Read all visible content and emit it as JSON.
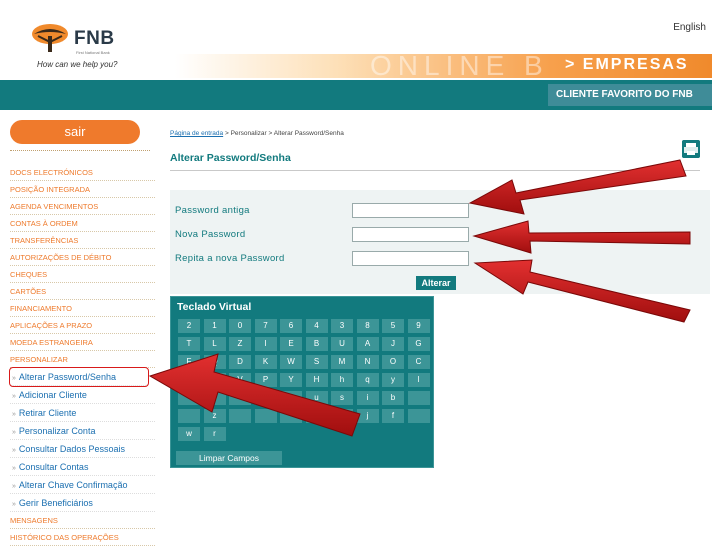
{
  "header": {
    "brand": "FNB",
    "brand_small": "First National Bank",
    "tagline": "How can we help you?",
    "language_link": "English",
    "band_watermark": "ONLINE B",
    "section": "> EMPRESAS",
    "client_label": "CLIENTE FAVORITO DO FNB"
  },
  "sidebar": {
    "logout_label": "sair",
    "items": [
      "DOCS ELECTRÓNICOS",
      "POSIÇÃO INTEGRADA",
      "AGENDA VENCIMENTOS",
      "CONTAS À ORDEM",
      "TRANSFERÊNCIAS",
      "AUTORIZAÇÕES DE DÉBITO",
      "CHEQUES",
      "CARTÕES",
      "FINANCIAMENTO",
      "APLICAÇÕES A PRAZO",
      "MOEDA ESTRANGEIRA",
      "PERSONALIZAR"
    ],
    "sub_items": [
      "Alterar Password/Senha",
      "Adicionar Cliente",
      "Retirar Cliente",
      "Personalizar Conta",
      "Consultar Dados Pessoais",
      "Consultar Contas",
      "Alterar Chave Confirmação",
      "Gerir Beneficiários"
    ],
    "bottom_items": [
      "MENSAGENS",
      "HISTÓRICO DAS OPERAÇÕES"
    ]
  },
  "breadcrumb": {
    "home": "Página de entrada",
    "sep1": " > ",
    "level1": "Personalizar",
    "sep2": " > ",
    "level2": "Alterar Password/Senha"
  },
  "page": {
    "title": "Alterar Password/Senha"
  },
  "form": {
    "old_password_label": "Password antiga",
    "new_password_label": "Nova Password",
    "repeat_password_label": "Repita a nova Password",
    "submit_label": "Alterar"
  },
  "keyboard": {
    "title": "Teclado Virtual",
    "rows": [
      [
        "2",
        "1",
        "0",
        "7",
        "6",
        "4",
        "3",
        "8",
        "5",
        "9"
      ],
      [
        "T",
        "L",
        "Z",
        "I",
        "E",
        "B",
        "U",
        "A",
        "J",
        "G"
      ],
      [
        "F",
        "Q",
        "D",
        "K",
        "W",
        "S",
        "M",
        "N",
        "O",
        "C"
      ],
      [
        "",
        "",
        "V",
        "P",
        "Y",
        "H",
        "h",
        "q",
        "y",
        "l"
      ],
      [
        "",
        "",
        "",
        "",
        "m",
        "u",
        "s",
        "i",
        "b",
        ""
      ],
      [
        "",
        "z",
        "",
        "",
        "",
        "",
        "a",
        "j",
        "f",
        ""
      ],
      [
        "w",
        "r"
      ]
    ],
    "clear_label": "Limpar Campos"
  },
  "colors": {
    "teal": "#127a7e",
    "orange": "#ef7a2c",
    "arrow_red": "#c81818"
  }
}
